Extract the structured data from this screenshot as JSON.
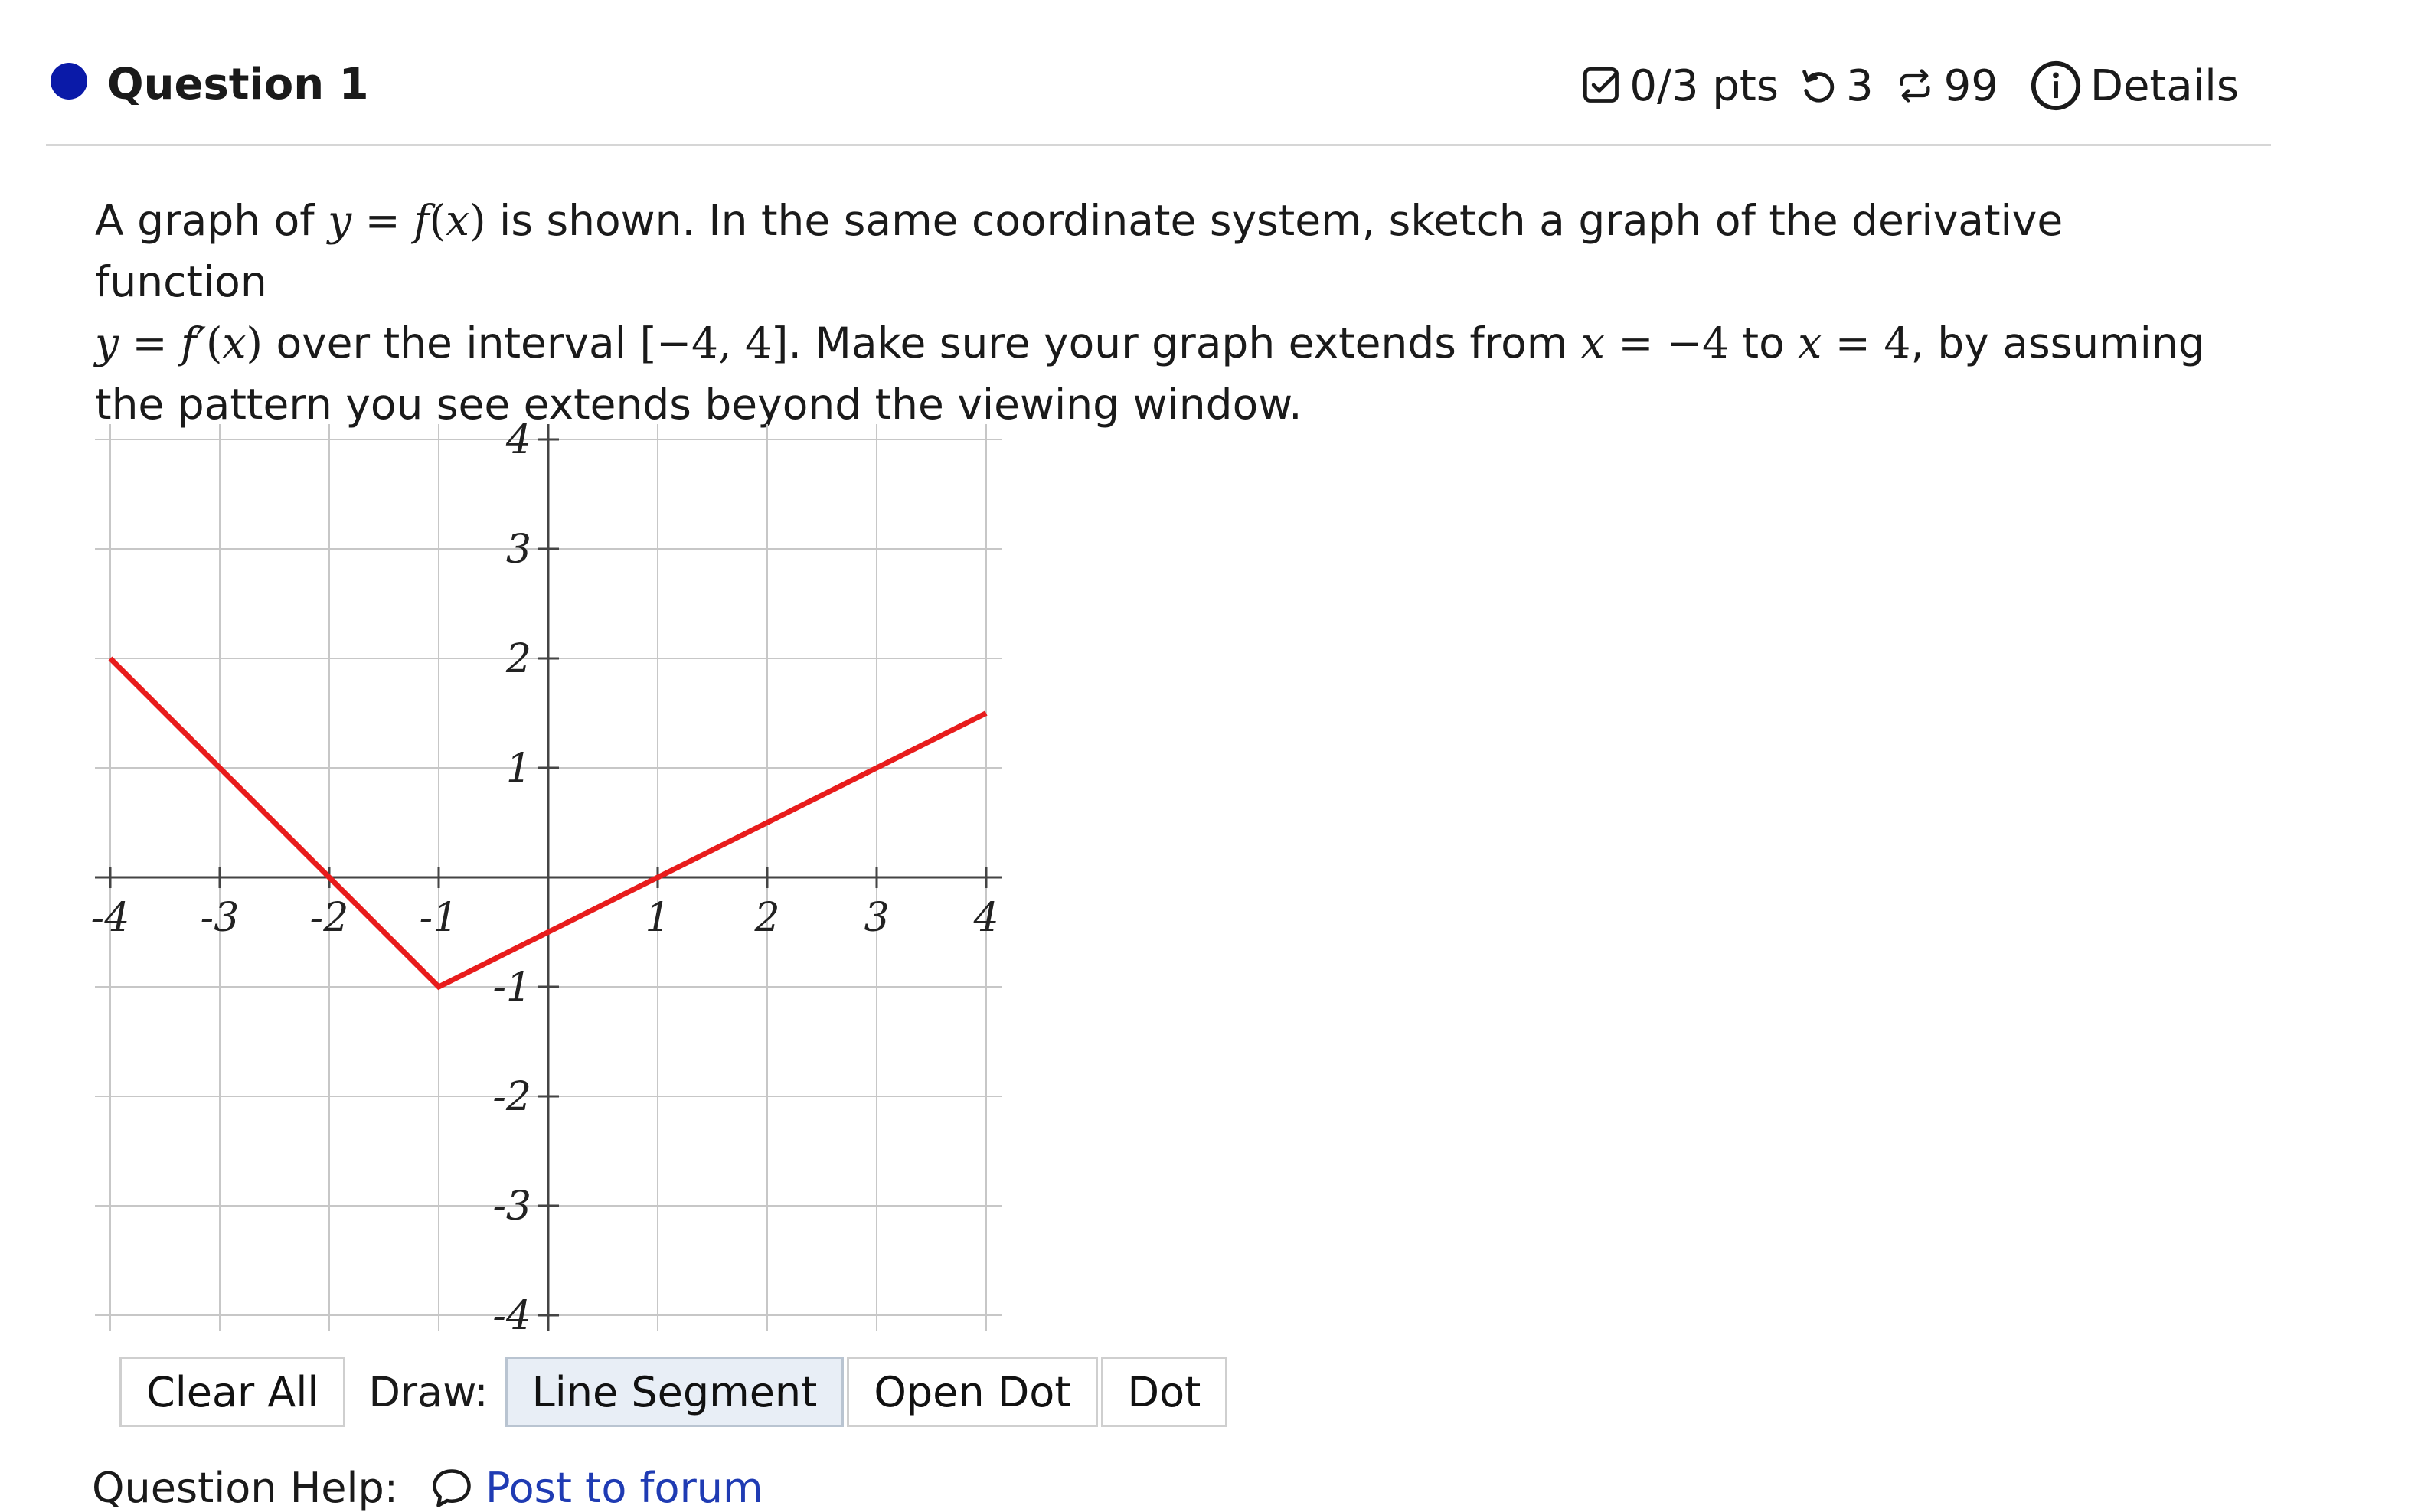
{
  "question": {
    "title": "Question 1",
    "points": "0/3 pts",
    "retries": "3",
    "attempts": "99",
    "details_label": "Details",
    "status_color": "#0a1aa8"
  },
  "prompt": {
    "t1": "A graph of ",
    "t2": " is shown. In the same coordinate system, sketch a graph of the derivative function",
    "t3": " over the interval ",
    "t4": ". Make sure your graph extends from ",
    "t5": " to ",
    "t6": ", by assuming",
    "t7": "the pattern you see extends beyond the viewing window."
  },
  "math": {
    "y": "y",
    "eq": " = ",
    "f": "f",
    "x": "x",
    "lp": "(",
    "rp": ")",
    "fprime": "f′",
    "interval": "[−4, 4]",
    "minus4": "−4",
    "four": "4"
  },
  "chart_data": {
    "type": "line",
    "xlim": [
      -4,
      4
    ],
    "ylim": [
      -4,
      4
    ],
    "grid": true,
    "x_ticks": [
      -4,
      -3,
      -2,
      -1,
      1,
      2,
      3,
      4
    ],
    "y_ticks": [
      -4,
      -3,
      -2,
      -1,
      1,
      2,
      3,
      4
    ],
    "x_tick_labels": [
      "-4",
      "-3",
      "-2",
      "-1",
      "1",
      "2",
      "3",
      "4"
    ],
    "y_tick_labels": [
      "-4",
      "-3",
      "-2",
      "-1",
      "1",
      "2",
      "3",
      "4"
    ],
    "series": [
      {
        "color": "#e81c1c",
        "x": [
          -4,
          -1,
          4
        ],
        "y": [
          2,
          -1,
          1.5
        ]
      }
    ]
  },
  "toolbar": {
    "clear_all": "Clear All",
    "draw_label": "Draw:",
    "line_segment": "Line Segment",
    "open_dot": "Open Dot",
    "dot": "Dot"
  },
  "help": {
    "label": "Question Help:",
    "post_to_forum": "Post to forum"
  }
}
